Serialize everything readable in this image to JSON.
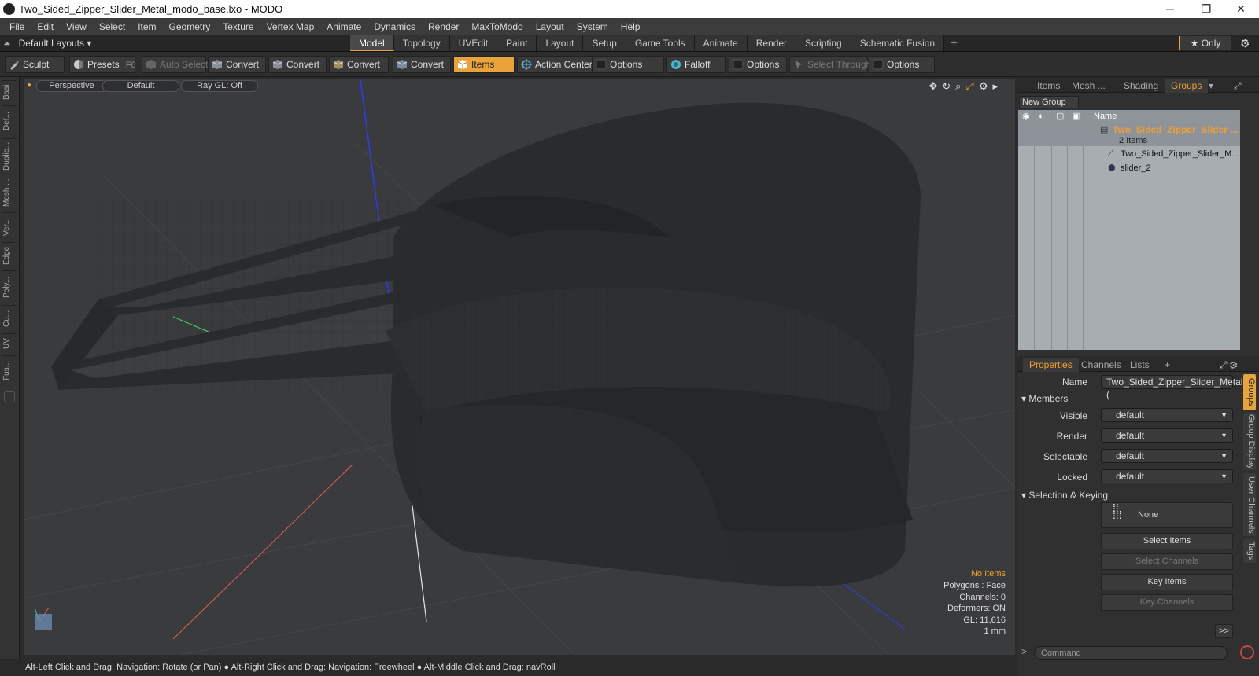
{
  "window": {
    "title": "Two_Sided_Zipper_Slider_Metal_modo_base.lxo - MODO",
    "minimize": "─",
    "restore": "❐",
    "close": "✕"
  },
  "menu": [
    "File",
    "Edit",
    "View",
    "Select",
    "Item",
    "Geometry",
    "Texture",
    "Vertex Map",
    "Animate",
    "Dynamics",
    "Render",
    "MaxToModo",
    "Layout",
    "System",
    "Help"
  ],
  "layouts": {
    "label": "Default Layouts ▾"
  },
  "tabs": [
    "Model",
    "Topology",
    "UVEdit",
    "Paint",
    "Layout",
    "Setup",
    "Game Tools",
    "Animate",
    "Render",
    "Scripting",
    "Schematic Fusion"
  ],
  "only_label": "★  Only",
  "toolbar": {
    "sculpt": "Sculpt",
    "presets": "Presets",
    "presets_key": "F6",
    "auto_select": "Auto Select",
    "convert": "Convert",
    "items": "Items",
    "action_center": "Action Center",
    "options": "Options",
    "falloff": "Falloff",
    "select_through": "Select Through"
  },
  "left_tabs": [
    "Basi",
    "Def...",
    "Duplic...",
    "Mesh ...",
    "Ver...",
    "Edge",
    "Poly...",
    "Cu...",
    "UV",
    "Fus..."
  ],
  "viewport": {
    "view": "Perspective",
    "shading": "Default",
    "raygl": "Ray GL: Off",
    "stats": {
      "selection": "No Items",
      "polygons": "Polygons : Face",
      "channels": "Channels: 0",
      "deformers": "Deformers: ON",
      "gl": "GL: 11,616",
      "unit": "1 mm"
    }
  },
  "statusbar": {
    "hints": "Alt-Left Click and Drag: Navigation: Rotate (or Pan) ● Alt-Right Click and Drag: Navigation: Freewheel ● Alt-Middle Click and Drag: navRoll"
  },
  "panel_top": {
    "tabs": [
      "Items",
      "Mesh ...",
      "Shading",
      "Groups"
    ],
    "new_group": "New Group",
    "name_col": "Name",
    "group_name": "Two_Sided_Zipper_Slider ...",
    "group_count": "2 Items",
    "children": [
      "Two_Sided_Zipper_Slider_M...",
      "slider_2"
    ]
  },
  "properties": {
    "tabs": [
      "Properties",
      "Channels",
      "Lists"
    ],
    "name_label": "Name",
    "name_value": "Two_Sided_Zipper_Slider_Metal (",
    "members": "Members",
    "rows": [
      {
        "label": "Visible",
        "value": "default"
      },
      {
        "label": "Render",
        "value": "default"
      },
      {
        "label": "Selectable",
        "value": "default"
      },
      {
        "label": "Locked",
        "value": "default"
      }
    ],
    "sel_keying": "Selection & Keying",
    "none": "None",
    "buttons": [
      "Select Items",
      "Select Channels",
      "Key Items",
      "Key Channels"
    ],
    "more": ">>",
    "side_tabs": [
      "Groups",
      "Group Display",
      "User Channels",
      "Tags"
    ],
    "command_placeholder": "Command"
  },
  "colors": {
    "accent": "#e8a33a",
    "viewport_bg": "#3a3b3d",
    "mesh": "#2a2b2d"
  }
}
